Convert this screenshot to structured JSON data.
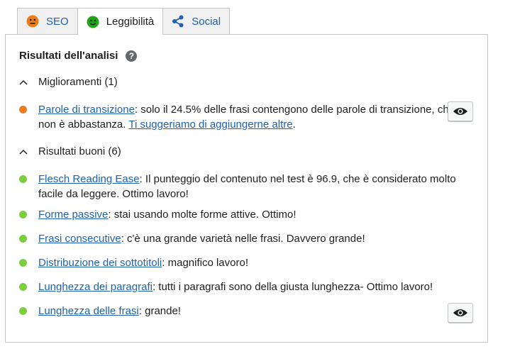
{
  "tabs": [
    {
      "label": "SEO",
      "icon": "face-neutral-icon"
    },
    {
      "label": "Leggibilità",
      "icon": "face-happy-icon"
    },
    {
      "label": "Social",
      "icon": "share-icon"
    }
  ],
  "colors": {
    "orange": "#ee7c1b",
    "green": "#7ad03a",
    "link": "#1d62b3"
  },
  "panel": {
    "title": "Risultati dell'analisi",
    "help_glyph": "?",
    "improvements": {
      "header": "Miglioramenti (1)",
      "items": [
        {
          "link": "Parole di transizione",
          "text": ": solo il 24.5% delle frasi contengono delle parole di transizione, che non è abbastanza. ",
          "link2": "Ti suggeriamo di aggiungerne altre",
          "tail": "."
        }
      ]
    },
    "good": {
      "header": "Risultati buoni (6)",
      "items": [
        {
          "link": "Flesch Reading Ease",
          "text": ": Il punteggio del contenuto nel test è 96.9, che è considerato molto facile da leggere. Ottimo lavoro!"
        },
        {
          "link": "Forme passive",
          "text": ": stai usando molte forme attive. Ottimo!"
        },
        {
          "link": "Frasi consecutive",
          "text": ": c'è una grande varietà nelle frasi. Davvero grande!"
        },
        {
          "link": "Distribuzione dei sottotitoli",
          "text": ": magnifico lavoro!"
        },
        {
          "link": "Lunghezza dei paragrafi",
          "text": ": tutti i paragrafi sono della giusta lunghezza- Ottimo lavoro!"
        },
        {
          "link": "Lunghezza delle frasi",
          "text": ": grande!"
        }
      ]
    }
  }
}
